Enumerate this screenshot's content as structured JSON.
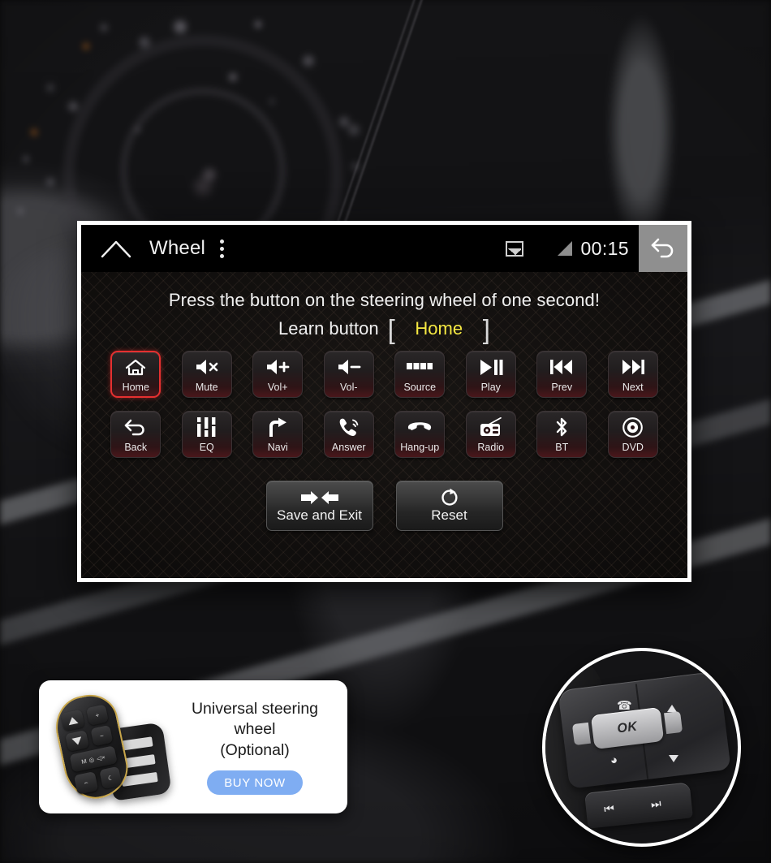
{
  "statusbar": {
    "home_icon": "home-outline-icon",
    "title": "Wheel",
    "overflow_icon": "kebab-menu-icon",
    "picture_icon": "picture-icon",
    "signal_icon": "signal-triangle-icon",
    "time": "00:15",
    "back_icon": "back-arrow-icon"
  },
  "instructions": {
    "line1": "Press the button on the steering wheel of one second!",
    "learn_label": "Learn button",
    "bracket_left": "[",
    "learned_value": "Home",
    "bracket_right": "]",
    "learned_color": "#f5e842"
  },
  "keys": [
    {
      "label": "Home",
      "icon": "home-icon",
      "selected": true
    },
    {
      "label": "Mute",
      "icon": "volume-mute-icon",
      "selected": false
    },
    {
      "label": "Vol+",
      "icon": "volume-up-icon",
      "selected": false
    },
    {
      "label": "Vol-",
      "icon": "volume-down-icon",
      "selected": false
    },
    {
      "label": "Source",
      "icon": "source-squares-icon",
      "selected": false
    },
    {
      "label": "Play",
      "icon": "play-pause-icon",
      "selected": false
    },
    {
      "label": "Prev",
      "icon": "previous-track-icon",
      "selected": false
    },
    {
      "label": "Next",
      "icon": "next-track-icon",
      "selected": false
    },
    {
      "label": "Back",
      "icon": "back-arrow-icon",
      "selected": false
    },
    {
      "label": "EQ",
      "icon": "equalizer-icon",
      "selected": false
    },
    {
      "label": "Navi",
      "icon": "turn-right-icon",
      "selected": false
    },
    {
      "label": "Answer",
      "icon": "phone-answer-icon",
      "selected": false
    },
    {
      "label": "Hang-up",
      "icon": "phone-hangup-icon",
      "selected": false
    },
    {
      "label": "Radio",
      "icon": "radio-icon",
      "selected": false
    },
    {
      "label": "BT",
      "icon": "bluetooth-icon",
      "selected": false
    },
    {
      "label": "DVD",
      "icon": "disc-icon",
      "selected": false
    }
  ],
  "actions": [
    {
      "label": "Save and Exit",
      "icon": "arrows-inward-icon"
    },
    {
      "label": "Reset",
      "icon": "refresh-icon"
    }
  ],
  "promo": {
    "title_line1": "Universal steering wheel",
    "title_line2": "(Optional)",
    "buy_label": "BUY NOW",
    "buy_color": "#7fadf2",
    "product_icon": "steering-wheel-remote-icon"
  },
  "photo": {
    "caption_icon": "steering-wheel-photo",
    "ok_label": "OK"
  },
  "theme": {
    "accent_red": "#e53030",
    "screen_border": "#ffffff",
    "statusbar_bg": "#000000"
  }
}
